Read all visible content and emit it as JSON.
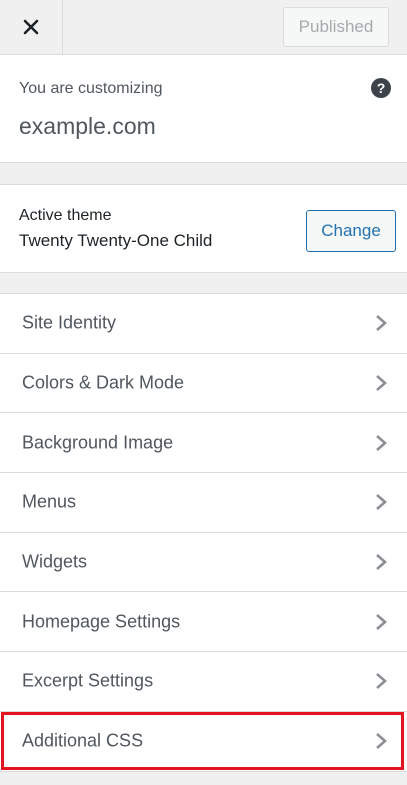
{
  "header": {
    "close_icon": "close-icon",
    "published_label": "Published"
  },
  "customizing": {
    "label": "You are customizing",
    "site": "example.com",
    "help_icon": "help-icon",
    "help_glyph": "?"
  },
  "theme": {
    "label": "Active theme",
    "name": "Twenty Twenty-One Child",
    "change_label": "Change"
  },
  "sections": [
    {
      "label": "Site Identity"
    },
    {
      "label": "Colors & Dark Mode"
    },
    {
      "label": "Background Image"
    },
    {
      "label": "Menus"
    },
    {
      "label": "Widgets"
    },
    {
      "label": "Homepage Settings"
    },
    {
      "label": "Excerpt Settings"
    },
    {
      "label": "Additional CSS",
      "highlighted": true
    }
  ],
  "colors": {
    "accent": "#2271b1",
    "highlight": "#e3141f"
  }
}
